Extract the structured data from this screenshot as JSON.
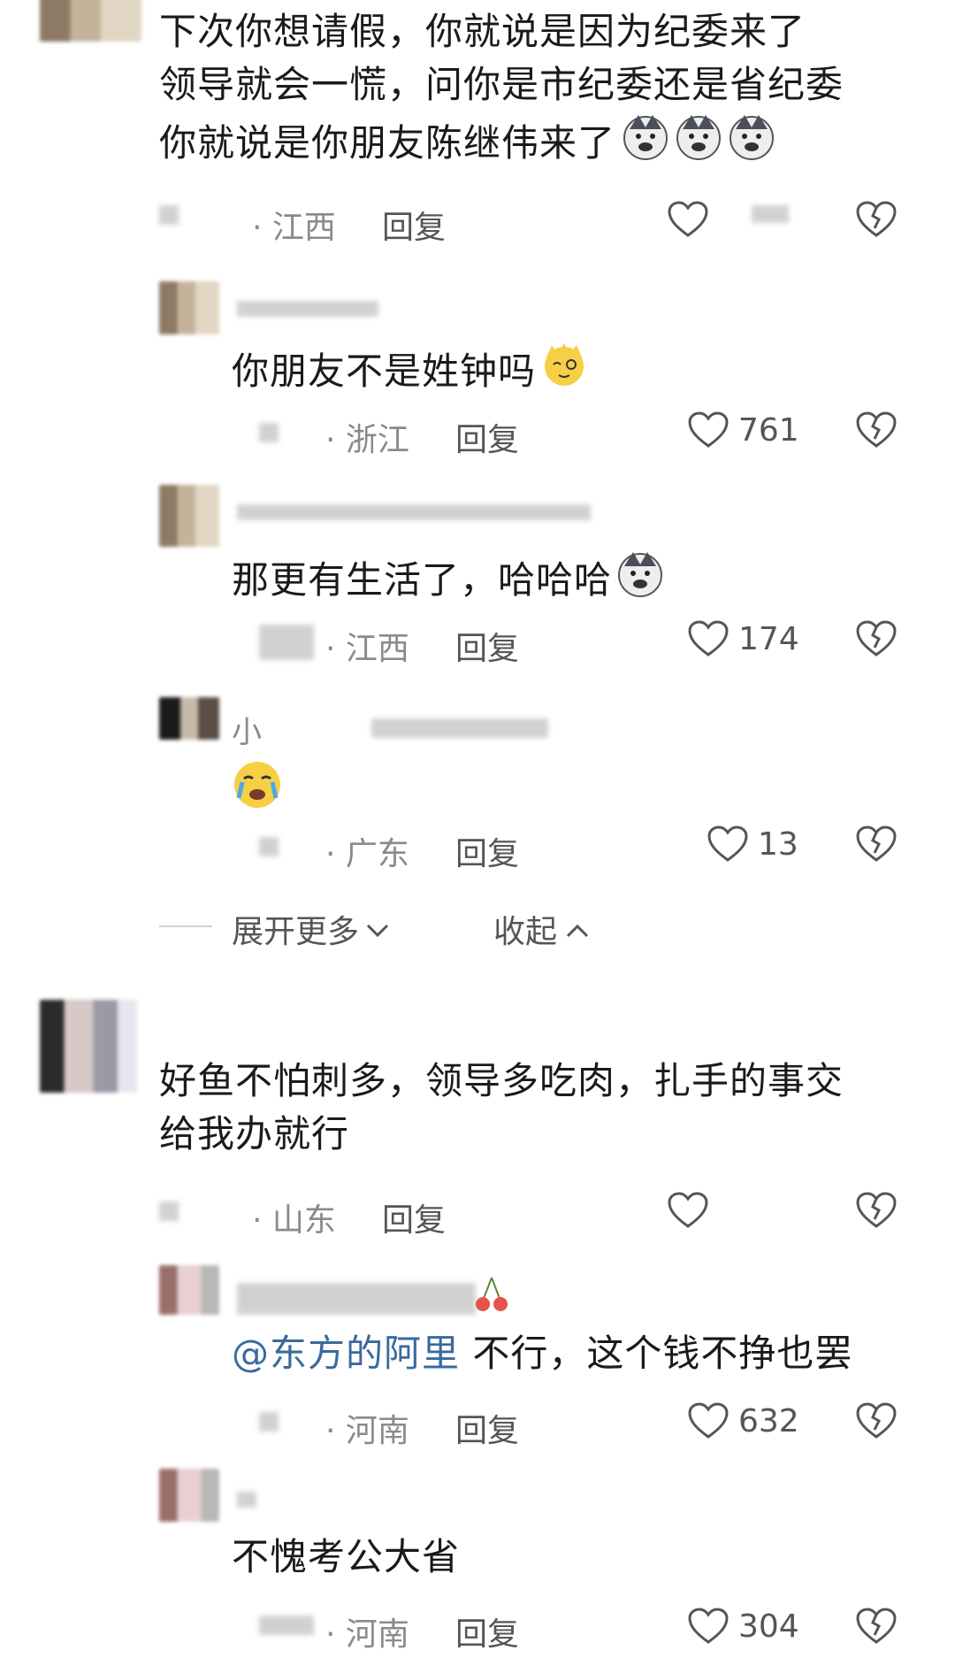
{
  "comments": [
    {
      "lines": [
        "下次你想请假，你就说是因为纪委来了",
        "领导就会一慌，问你是市纪委还是省纪委",
        "你就说是你朋友陈继伟来了"
      ],
      "location": "· 江西",
      "reply": "回复",
      "replies": [
        {
          "text": "你朋友不是姓钟吗",
          "location": "· 浙江",
          "reply": "回复",
          "likes": "761"
        },
        {
          "text": "那更有生活了，哈哈哈",
          "location": "· 江西",
          "reply": "回复",
          "likes": "174"
        },
        {
          "name": "小",
          "location": "· 广东",
          "reply": "回复",
          "likes": "13"
        }
      ],
      "expand_more": "展开更多",
      "collapse": "收起"
    },
    {
      "lines": [
        "好鱼不怕刺多，领导多吃肉，扎手的事交",
        "给我办就行"
      ],
      "location": "· 山东",
      "reply": "回复",
      "replies": [
        {
          "mention": "@东方的阿里",
          "text": " 不行，这个钱不挣也罢",
          "location": "· 河南",
          "reply": "回复",
          "likes": "632"
        },
        {
          "text": "不愧考公大省",
          "location": "· 河南",
          "reply": "回复",
          "likes": "304"
        }
      ]
    }
  ],
  "colors": {
    "mention": "#3a6a9e",
    "meta": "#8a8a8a",
    "text": "#1a1a1a"
  }
}
